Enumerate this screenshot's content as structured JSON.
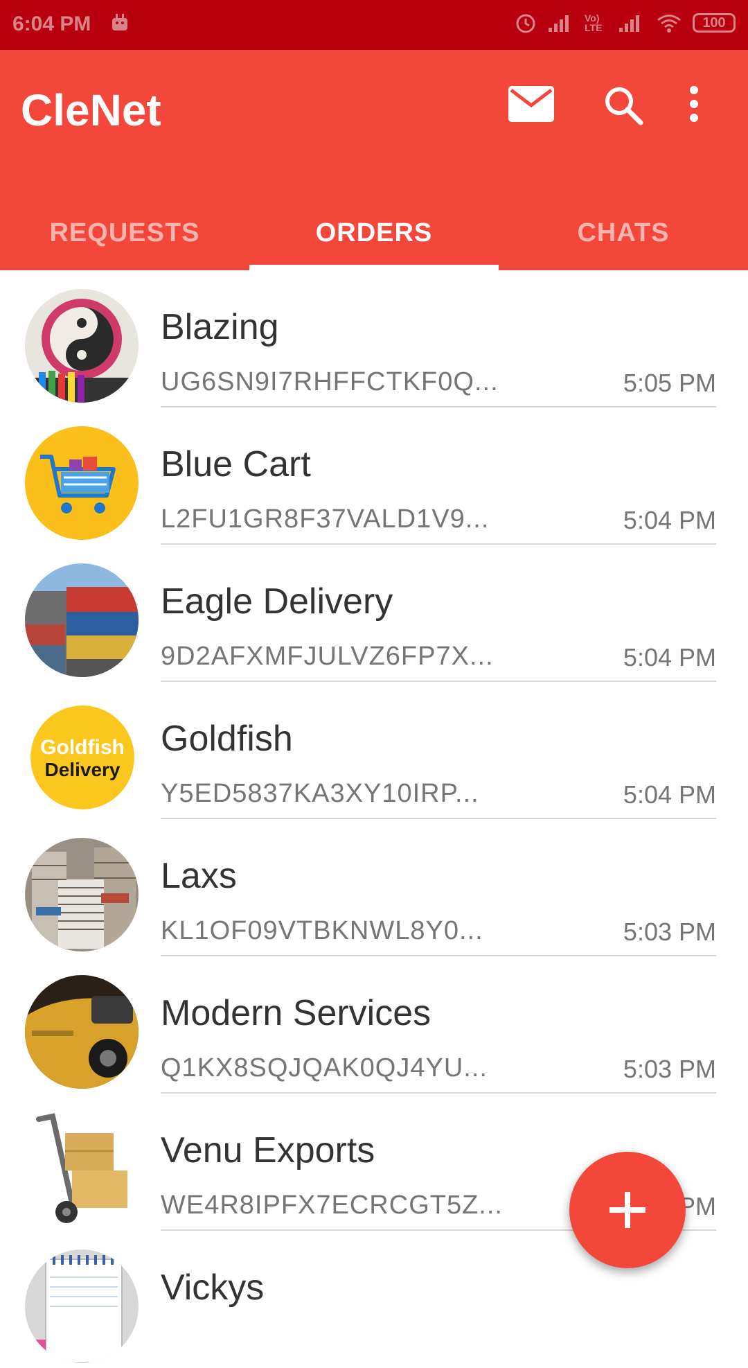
{
  "status_bar": {
    "time": "6:04 PM",
    "battery": "100",
    "network": "Vo) LTE"
  },
  "app_bar": {
    "title": "CleNet"
  },
  "tabs": [
    {
      "label": "REQUESTS",
      "active": false
    },
    {
      "label": "ORDERS",
      "active": true
    },
    {
      "label": "CHATS",
      "active": false
    }
  ],
  "orders": [
    {
      "name": "Blazing",
      "code": "UG6SN9I7RHFFCTKF0Q...",
      "time": "5:05 PM",
      "avatar": "yin-yang-art"
    },
    {
      "name": "Blue Cart",
      "code": "L2FU1GR8F37VALD1V9...",
      "time": "5:04 PM",
      "avatar": "shopping-cart"
    },
    {
      "name": "Eagle Delivery",
      "code": "9D2AFXMFJULVZ6FP7X...",
      "time": "5:04 PM",
      "avatar": "shipping-containers"
    },
    {
      "name": "Goldfish",
      "code": "Y5ED5837KA3XY10IRP...",
      "time": "5:04 PM",
      "avatar": "goldfish-delivery-logo",
      "logo_text": [
        "Goldfish",
        "Delivery"
      ]
    },
    {
      "name": "Laxs",
      "code": "KL1OF09VTBKNWL8Y0...",
      "time": "5:03 PM",
      "avatar": "book-stacks"
    },
    {
      "name": "Modern Services",
      "code": "Q1KX8SQJQAK0QJ4YU...",
      "time": "5:03 PM",
      "avatar": "yellow-vintage-car"
    },
    {
      "name": "Venu Exports",
      "code": "WE4R8IPFX7ECRCGT5Z...",
      "time": "PM",
      "avatar": "hand-truck-boxes"
    },
    {
      "name": "Vickys",
      "code": "",
      "time": "",
      "avatar": "notepad"
    }
  ],
  "fab": {
    "icon": "plus-icon"
  },
  "colors": {
    "primary": "#f4473c",
    "status_bar": "#b9000f",
    "accent_white": "#ffffff"
  }
}
